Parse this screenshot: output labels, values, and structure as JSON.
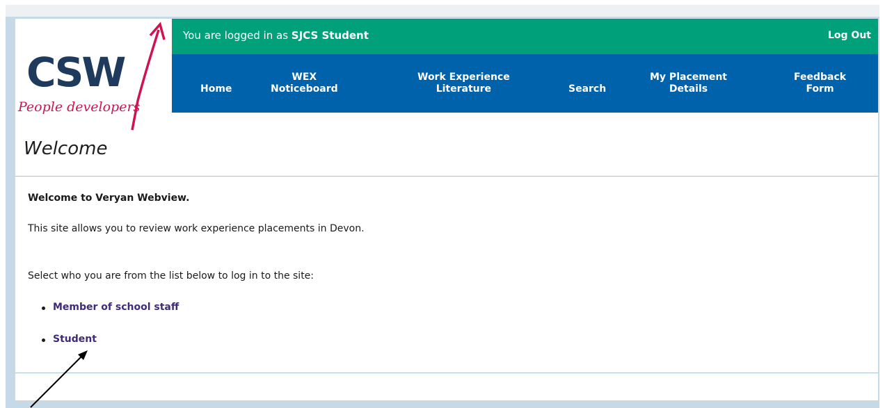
{
  "logo": {
    "text": "CSW",
    "tagline": "People developers",
    "colors": {
      "csw": "#1e3a5c",
      "accent": "#d0124f"
    }
  },
  "header": {
    "login_prefix": "You are logged in as ",
    "user_name": "SJCS Student",
    "logout_label": "Log Out"
  },
  "nav": {
    "items": [
      {
        "lines": [
          "Home"
        ]
      },
      {
        "lines": [
          "WEX",
          "Noticeboard"
        ]
      },
      {
        "lines": [
          "Work Experience",
          "Literature"
        ]
      },
      {
        "lines": [
          "Search"
        ]
      },
      {
        "lines": [
          "My Placement",
          "Details"
        ]
      },
      {
        "lines": [
          "Feedback",
          "Form"
        ]
      }
    ]
  },
  "page": {
    "title": "Welcome",
    "intro_heading": "Welcome to Veryan Webview.",
    "description": "This site allows you to review work experience placements in Devon.",
    "select_prompt": "Select who you are from the list below to log in to the site:",
    "roles": [
      "Member of school staff",
      "Student"
    ]
  },
  "colors": {
    "login_bar": "#00a07b",
    "nav_bar": "#0062aa",
    "frame": "#c6d9e6",
    "link": "#3f2a7a"
  }
}
